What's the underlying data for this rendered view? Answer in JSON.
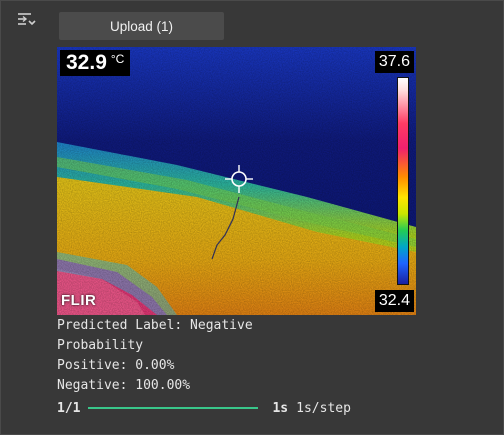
{
  "toolbar": {
    "cell_toggle_icon": "output-toggle-icon",
    "upload_label": "Upload (1)"
  },
  "thermal_image": {
    "spot_temperature": "32.9",
    "unit": "°C",
    "scale_max": "37.6",
    "scale_min": "32.4",
    "logo": "FLIR",
    "crosshair_icon": "crosshair-icon"
  },
  "output": {
    "predicted_label": "Predicted Label: Negative",
    "probability_heading": "Probability",
    "positive": "Positive: 0.00%",
    "negative": "Negative: 100.00%"
  },
  "progress": {
    "step": "1/1",
    "fraction": 1.0,
    "elapsed": "1s",
    "rate": "1s/step",
    "bar_color": "#39c68a"
  }
}
